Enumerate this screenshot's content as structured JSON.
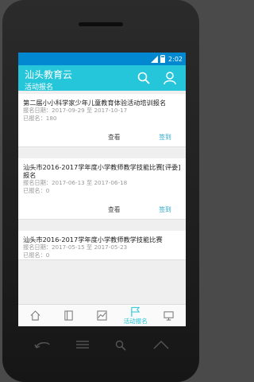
{
  "status_bar": {
    "time": "2:02",
    "signal_icon": "signal-icon",
    "battery_icon": "battery-icon"
  },
  "app_bar": {
    "title": "汕头教育云",
    "subtitle": "活动报名",
    "search_icon": "search-icon",
    "user_icon": "user-icon"
  },
  "activities": [
    {
      "title": "第二届小小科学家少年儿童教育体验活动培训报名",
      "date": "报名日期：2017-09-29 至 2017-10-17",
      "count": "已报名：180",
      "view_label": "查看",
      "signin_label": "签到"
    },
    {
      "title": "汕头市2016-2017学年度小学教师教学技能比赛[评委]报名",
      "date": "报名日期：2017-06-13 至 2017-06-18",
      "count": "已报名：0",
      "view_label": "查看",
      "signin_label": "签到"
    },
    {
      "title": "汕头市2016-2017学年度小学教师教学技能比赛",
      "date": "报名日期：2017-05-15 至 2017-05-23",
      "count": "已报名：0",
      "view_label": "",
      "signin_label": ""
    }
  ],
  "bottom_nav": [
    {
      "icon": "home-icon",
      "label": "",
      "active": false
    },
    {
      "icon": "book-icon",
      "label": "",
      "active": false
    },
    {
      "icon": "chart-icon",
      "label": "",
      "active": false
    },
    {
      "icon": "flag-icon",
      "label": "活动报名",
      "active": true
    },
    {
      "icon": "monitor-icon",
      "label": "",
      "active": false
    }
  ],
  "colors": {
    "accent": "#26c6da",
    "status_bar": "#0288d1",
    "signin": "#26a4c9"
  }
}
